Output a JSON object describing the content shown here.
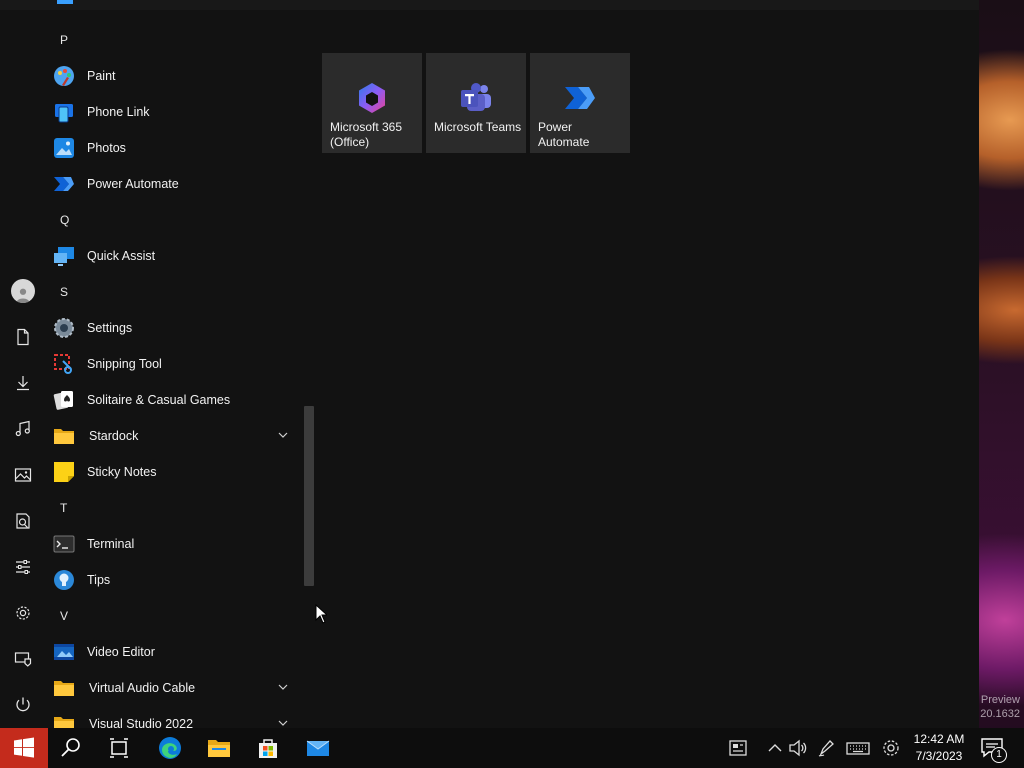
{
  "desktop": {
    "watermark_line1": "Preview",
    "watermark_line2": "20.1632"
  },
  "app_list": {
    "items": [
      {
        "kind": "letter",
        "label": "P"
      },
      {
        "kind": "app",
        "label": "Paint",
        "icon": "paint-icon"
      },
      {
        "kind": "app",
        "label": "Phone Link",
        "icon": "phone-link-icon"
      },
      {
        "kind": "app",
        "label": "Photos",
        "icon": "photos-icon"
      },
      {
        "kind": "app",
        "label": "Power Automate",
        "icon": "power-automate-icon"
      },
      {
        "kind": "letter",
        "label": "Q"
      },
      {
        "kind": "app",
        "label": "Quick Assist",
        "icon": "quick-assist-icon"
      },
      {
        "kind": "letter",
        "label": "S"
      },
      {
        "kind": "app",
        "label": "Settings",
        "icon": "settings-gear-icon"
      },
      {
        "kind": "app",
        "label": "Snipping Tool",
        "icon": "snipping-tool-icon"
      },
      {
        "kind": "app",
        "label": "Solitaire & Casual Games",
        "icon": "solitaire-icon"
      },
      {
        "kind": "folder",
        "label": "Stardock",
        "icon": "folder-icon"
      },
      {
        "kind": "app",
        "label": "Sticky Notes",
        "icon": "sticky-notes-icon"
      },
      {
        "kind": "letter",
        "label": "T"
      },
      {
        "kind": "app",
        "label": "Terminal",
        "icon": "terminal-icon"
      },
      {
        "kind": "app",
        "label": "Tips",
        "icon": "tips-icon"
      },
      {
        "kind": "letter",
        "label": "V"
      },
      {
        "kind": "app",
        "label": "Video Editor",
        "icon": "video-editor-icon"
      },
      {
        "kind": "folder",
        "label": "Virtual Audio Cable",
        "icon": "folder-icon"
      },
      {
        "kind": "folder",
        "label": "Visual Studio 2022",
        "icon": "folder-icon"
      }
    ]
  },
  "tiles": [
    {
      "label": "Microsoft 365 (Office)",
      "icon": "microsoft-365-icon"
    },
    {
      "label": "Microsoft Teams",
      "icon": "teams-icon"
    },
    {
      "label": "Power Automate",
      "icon": "power-automate-icon"
    }
  ],
  "taskbar": {
    "time": "12:42 AM",
    "date": "7/3/2023",
    "notification_count": "1"
  },
  "colors": {
    "start_button": "#c42b1c",
    "menu_background": "#121212",
    "tile_background": "#2b2b2b"
  }
}
